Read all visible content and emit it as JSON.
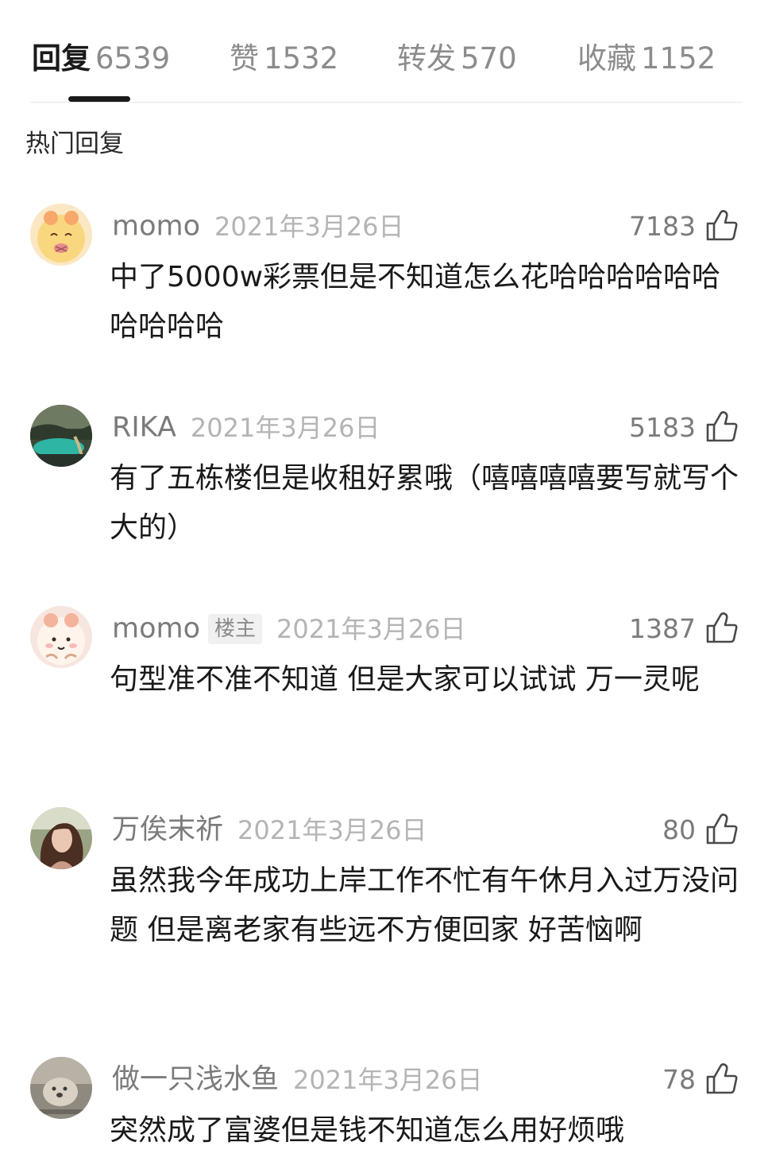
{
  "tabs": [
    {
      "label": "回复",
      "count": "6539",
      "active": true
    },
    {
      "label": "赞",
      "count": "1532",
      "active": false
    },
    {
      "label": "转发",
      "count": "570",
      "active": false
    },
    {
      "label": "收藏",
      "count": "1152",
      "active": false
    }
  ],
  "section_title": "热门回复",
  "comments": [
    {
      "username": "momo",
      "badge": "",
      "timestamp": "2021年3月26日",
      "likes": "7183",
      "text": "中了5000w彩票但是不知道怎么花哈哈哈哈哈哈哈哈哈哈"
    },
    {
      "username": "RIKA",
      "badge": "",
      "timestamp": "2021年3月26日",
      "likes": "5183",
      "text": "有了五栋楼但是收租好累哦（嘻嘻嘻嘻要写就写个大的）"
    },
    {
      "username": "momo",
      "badge": "楼主",
      "timestamp": "2021年3月26日",
      "likes": "1387",
      "text": "句型准不准不知道 但是大家可以试试 万一灵呢"
    },
    {
      "username": "万俟末祈",
      "badge": "",
      "timestamp": "2021年3月26日",
      "likes": "80",
      "text": "虽然我今年成功上岸工作不忙有午休月入过万没问题 但是离老家有些远不方便回家 好苦恼啊"
    },
    {
      "username": "做一只浅水鱼",
      "badge": "",
      "timestamp": "2021年3月26日",
      "likes": "78",
      "text": "突然成了富婆但是钱不知道怎么用好烦哦"
    }
  ],
  "icons": {
    "like": "thumbs-up-icon"
  }
}
